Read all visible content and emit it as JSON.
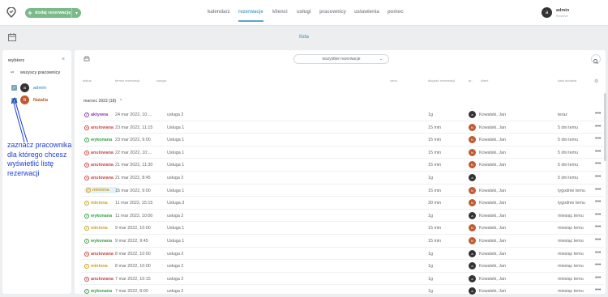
{
  "topbar": {
    "add_button_label": "dodaj rezerwację",
    "nav": [
      "kalendarz",
      "rezerwacje",
      "klienci",
      "usługi",
      "pracownicy",
      "ustawienia",
      "pomoc"
    ],
    "user_initial": "a",
    "user_name": "admin",
    "user_sub": "Reserve"
  },
  "subbar": {
    "list_tab": "lista"
  },
  "sidebar": {
    "title": "wybierz",
    "all_label": "wszyscy pracownicy",
    "employees": [
      {
        "initial": "a",
        "name": "admin",
        "color": "#333333"
      },
      {
        "initial": "N",
        "name": "Natalia",
        "color": "#c05a30"
      }
    ]
  },
  "annotation": "zaznacz pracownika dla którego chcesz wyświetlić listę rezerwacji",
  "main": {
    "filter_value": "wszystkie rezerwacje",
    "columns": [
      "status",
      "termin rezerwacji",
      "usługa",
      "cena",
      "długość rezerwacji",
      "pr...",
      "klient",
      "data dodania"
    ],
    "group_label": "marzec 2022 (18)",
    "rows": [
      {
        "status": "aktywna",
        "date": "24 mar 2022, 10:...",
        "service": "usługa 2",
        "duration": "1g",
        "emp": "a",
        "client": "Kowalski, Jan",
        "added": "teraz"
      },
      {
        "status": "anulowana",
        "date": "23 mar 2022, 11:15",
        "service": "Usługa 1",
        "duration": "15 min",
        "emp": "N",
        "client": "Kowalski, Jan",
        "added": "5 dni temu"
      },
      {
        "status": "wykonana",
        "date": "23 mar 2022, 9:00",
        "service": "Usługa 1",
        "duration": "15 min",
        "emp": "N",
        "client": "Kowalski, Jan",
        "added": "5 dni temu"
      },
      {
        "status": "anulowana",
        "date": "22 mar 2022, 10:...",
        "service": "Usługa 1",
        "duration": "15 min",
        "emp": "N",
        "client": "Kowalski, Jan",
        "added": "5 dni temu"
      },
      {
        "status": "anulowana",
        "date": "21 mar 2022, 11:30",
        "service": "Usługa 1",
        "duration": "15 min",
        "emp": "N",
        "client": "Kowalski, Jan",
        "added": "5 dni temu"
      },
      {
        "status": "anulowana",
        "date": "21 mar 2022, 8:45",
        "service": "usługa 2",
        "duration": "1g",
        "emp": "a",
        "client": "",
        "added": "5 dni temu"
      },
      {
        "status": "miniona",
        "date": "15 mar 2022, 9:00",
        "service": "Usługa 1",
        "duration": "15 min",
        "emp": "N",
        "client": "Kowalski, Jan",
        "added": "tygodnie temu",
        "pill": true
      },
      {
        "status": "miniona",
        "date": "11 mar 2022, 15:15",
        "service": "Usługa 3",
        "duration": "30 min",
        "emp": "N",
        "client": "Kowalski, Jan",
        "added": "tygodnie temu"
      },
      {
        "status": "wykonana",
        "date": "11 mar 2022, 10:00",
        "service": "usługa 2",
        "duration": "1g",
        "emp": "a",
        "client": "Kowalski, Jan",
        "added": "miesiąc temu"
      },
      {
        "status": "miniona",
        "date": "9 mar 2022, 10:00",
        "service": "Usługa 1",
        "duration": "15 min",
        "emp": "N",
        "client": "Kowalski, Jan",
        "added": "miesiąc temu"
      },
      {
        "status": "wykonana",
        "date": "9 mar 2022, 9:45",
        "service": "Usługa 1",
        "duration": "15 min",
        "emp": "N",
        "client": "Kowalski, Jan",
        "added": "miesiąc temu"
      },
      {
        "status": "anulowana",
        "date": "8 mar 2022, 10:00",
        "service": "usługa 2",
        "duration": "1g",
        "emp": "a",
        "client": "Kowalski, Jan",
        "added": "miesiąc temu"
      },
      {
        "status": "miniona",
        "date": "8 mar 2022, 10:00",
        "service": "usługa 2",
        "duration": "1g",
        "emp": "a",
        "client": "Kowalski, Jan",
        "added": "miesiąc temu"
      },
      {
        "status": "anulowana",
        "date": "7 mar 2022, 10:15",
        "service": "usługa 2",
        "duration": "1g",
        "emp": "a",
        "client": "Kowalski, Jan",
        "added": "miesiąc temu"
      },
      {
        "status": "wykonana",
        "date": "7 mar 2022, 8:00",
        "service": "usługa 2",
        "duration": "1g",
        "emp": "a",
        "client": "Kowalski, Jan",
        "added": "miesiąc temu"
      }
    ]
  },
  "colors": {
    "accent": "#5aa5d0",
    "add_button": "#7bb98a",
    "annotation": "#1f3fd8"
  }
}
